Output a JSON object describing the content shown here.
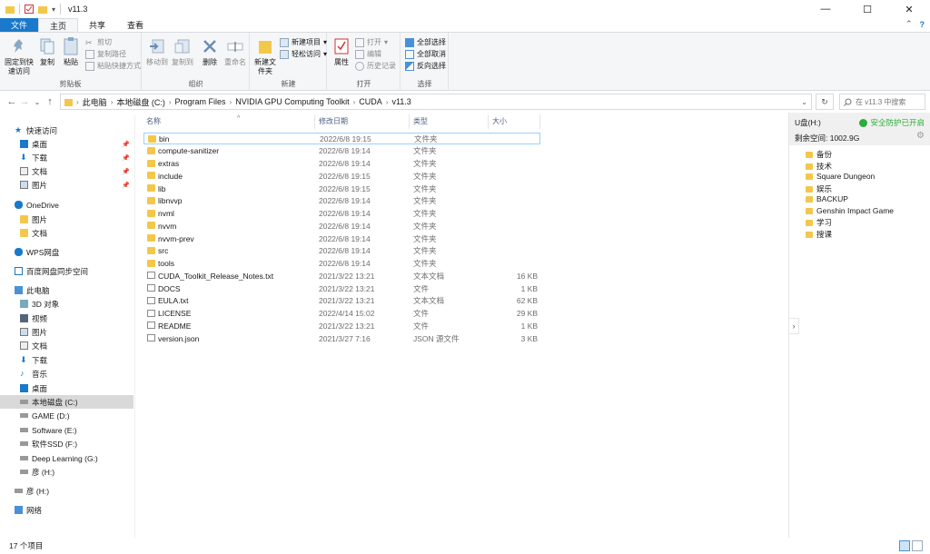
{
  "window": {
    "title": "v11.3",
    "controls": [
      "—",
      "☐",
      "✕"
    ]
  },
  "ribbon_tabs": [
    "文件",
    "主页",
    "共享",
    "查看"
  ],
  "ribbon": {
    "clipboard": {
      "label": "剪贴板",
      "pin": "固定到快速访问",
      "copy": "复制",
      "paste": "粘贴",
      "cut": "剪切",
      "copy_path": "复制路径",
      "paste_shortcut": "粘贴快捷方式"
    },
    "organize": {
      "label": "组织",
      "move_to": "移动到",
      "copy_to": "复制到",
      "delete": "删除",
      "rename": "重命名"
    },
    "new": {
      "label": "新建",
      "new_folder": "新建文件夹",
      "new_item": "新建项目",
      "easy_access": "轻松访问"
    },
    "open": {
      "label": "打开",
      "properties": "属性",
      "open": "打开",
      "edit": "编辑",
      "history": "历史记录"
    },
    "select": {
      "label": "选择",
      "select_all": "全部选择",
      "select_none": "全部取消",
      "invert": "反向选择"
    }
  },
  "address": {
    "breadcrumbs": [
      "此电脑",
      "本地磁盘 (C:)",
      "Program Files",
      "NVIDIA GPU Computing Toolkit",
      "CUDA",
      "v11.3"
    ],
    "search_placeholder": "在 v11.3 中搜索"
  },
  "nav": {
    "quick_access": "快速访问",
    "quick_items": [
      "桌面",
      "下载",
      "文档",
      "图片"
    ],
    "onedrive": "OneDrive",
    "onedrive_items": [
      "图片",
      "文档"
    ],
    "wps": "WPS网盘",
    "baidu": "百度网盘同步空间",
    "this_pc": "此电脑",
    "pc_items": [
      "3D 对象",
      "视频",
      "图片",
      "文档",
      "下载",
      "音乐",
      "桌面"
    ],
    "drives": [
      "本地磁盘 (C:)",
      "GAME (D:)",
      "Software (E:)",
      "软件SSD (F:)",
      "Deep Learning (G:)",
      "彦 (H:)"
    ],
    "usb": "彦 (H:)",
    "network": "网络"
  },
  "columns": {
    "name": "名称",
    "modified": "修改日期",
    "type": "类型",
    "size": "大小"
  },
  "files": [
    {
      "name": "bin",
      "date": "2022/6/8 19:15",
      "type": "文件夹",
      "size": "",
      "kind": "folder"
    },
    {
      "name": "compute-sanitizer",
      "date": "2022/6/8 19:14",
      "type": "文件夹",
      "size": "",
      "kind": "folder"
    },
    {
      "name": "extras",
      "date": "2022/6/8 19:14",
      "type": "文件夹",
      "size": "",
      "kind": "folder"
    },
    {
      "name": "include",
      "date": "2022/6/8 19:15",
      "type": "文件夹",
      "size": "",
      "kind": "folder"
    },
    {
      "name": "lib",
      "date": "2022/6/8 19:15",
      "type": "文件夹",
      "size": "",
      "kind": "folder"
    },
    {
      "name": "libnvvp",
      "date": "2022/6/8 19:14",
      "type": "文件夹",
      "size": "",
      "kind": "folder"
    },
    {
      "name": "nvml",
      "date": "2022/6/8 19:14",
      "type": "文件夹",
      "size": "",
      "kind": "folder"
    },
    {
      "name": "nvvm",
      "date": "2022/6/8 19:14",
      "type": "文件夹",
      "size": "",
      "kind": "folder"
    },
    {
      "name": "nvvm-prev",
      "date": "2022/6/8 19:14",
      "type": "文件夹",
      "size": "",
      "kind": "folder"
    },
    {
      "name": "src",
      "date": "2022/6/8 19:14",
      "type": "文件夹",
      "size": "",
      "kind": "folder"
    },
    {
      "name": "tools",
      "date": "2022/6/8 19:14",
      "type": "文件夹",
      "size": "",
      "kind": "folder"
    },
    {
      "name": "CUDA_Toolkit_Release_Notes.txt",
      "date": "2021/3/22 13:21",
      "type": "文本文档",
      "size": "16 KB",
      "kind": "doc"
    },
    {
      "name": "DOCS",
      "date": "2021/3/22 13:21",
      "type": "文件",
      "size": "1 KB",
      "kind": "doc"
    },
    {
      "name": "EULA.txt",
      "date": "2021/3/22 13:21",
      "type": "文本文档",
      "size": "62 KB",
      "kind": "doc"
    },
    {
      "name": "LICENSE",
      "date": "2022/4/14 15:02",
      "type": "文件",
      "size": "29 KB",
      "kind": "doc"
    },
    {
      "name": "README",
      "date": "2021/3/22 13:21",
      "type": "文件",
      "size": "1 KB",
      "kind": "doc"
    },
    {
      "name": "version.json",
      "date": "2021/3/27 7:16",
      "type": "JSON 源文件",
      "size": "3 KB",
      "kind": "doc"
    }
  ],
  "preview": {
    "drive": "U盘(H:)",
    "safe": "安全防护已开启",
    "free": "剩余空间: 1002.9G",
    "items": [
      "备份",
      "技术",
      "Square Dungeon",
      "娱乐",
      "BACKUP",
      "Genshin Impact Game",
      "学习",
      "搜课"
    ]
  },
  "status": {
    "count": "17 个项目"
  },
  "colors": {
    "file_tab": "#1979ca",
    "folder": "#f3c74a",
    "selection": "#d9d9d9",
    "safe_green": "#2aae39"
  }
}
